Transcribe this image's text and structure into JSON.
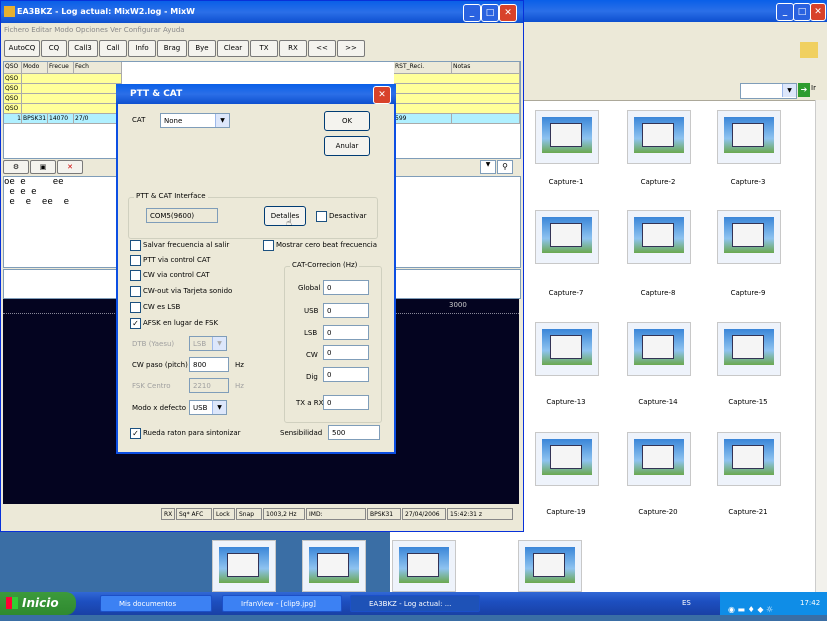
{
  "app": {
    "title": "EA3BKZ - Log actual: MixW2.log - MixW",
    "menu": "Fichero  Editar  Modo  Opciones  Ver  Configurar  Ayuda",
    "toolbar": [
      "AutoCQ",
      "CQ",
      "Call3",
      "Call",
      "Info",
      "Brag",
      "Bye",
      "Clear",
      "TX",
      "RX",
      "<<",
      ">>"
    ],
    "grid_headers": [
      "QSO",
      "Modo",
      "Frecue",
      "Fech",
      "",
      "",
      "",
      "",
      "",
      "RST_Reci.",
      "Notas"
    ],
    "grid_rows": [
      "QSO",
      "QSO",
      "QSO",
      "QSO"
    ],
    "grid_last": [
      "1",
      "BPSK31",
      "14070",
      "27/0",
      "",
      "",
      "",
      "",
      "",
      "599",
      ""
    ],
    "rx_line1": "oe e     ee",
    "rx_line2": " e e e",
    "rx_line3": " e  e  ee  e",
    "waterfall_freq": "3000",
    "status": {
      "rx": "RX",
      "sq": "Sq* AFC",
      "lock": "Lock",
      "snap": "Snap",
      "freq": "1003,2 Hz",
      "imd": "IMD:",
      "mode": "BPSK31",
      "date": "27/04/2006",
      "time": "15:42:31 z"
    }
  },
  "dialog": {
    "title": "PTT & CAT",
    "cat_label": "CAT",
    "cat_value": "None",
    "ok": "OK",
    "cancel": "Anular",
    "interface_group": "PTT & CAT Interface",
    "port": "COM5(9600)",
    "details": "Detalles",
    "deactivate": "Desactivar",
    "save_freq": "Salvar frecuencia al salir",
    "show_zero": "Mostrar cero beat frecuencia",
    "ptt_cat": "PTT via control CAT",
    "cw_cat": "CW via control CAT",
    "cw_sound": "CW-out via Tarjeta sonido",
    "cw_lsb": "CW es LSB",
    "afsk": "AFSK en lugar de FSK",
    "dtb": "DTB (Yaesu)",
    "dtb_val": "LSB",
    "cw_pitch": "CW paso (pitch)",
    "cw_pitch_val": "800",
    "hz": "Hz",
    "fsk_center": "FSK Centro",
    "fsk_val": "2210",
    "default_mode": "Modo x defecto",
    "default_mode_val": "USB",
    "cat_corr_group": "CAT-Correcion (Hz)",
    "corr": [
      {
        "label": "Global",
        "value": "0"
      },
      {
        "label": "USB",
        "value": "0"
      },
      {
        "label": "LSB",
        "value": "0"
      },
      {
        "label": "CW",
        "value": "0"
      },
      {
        "label": "Dig",
        "value": "0"
      }
    ],
    "tx_rx": "TX a RX",
    "tx_rx_val": "0",
    "wheel": "Rueda raton para sintonizar",
    "sens": "Sensibilidad",
    "sens_val": "500"
  },
  "explorer": {
    "captions": [
      "Capture-1",
      "Capture-2",
      "Capture-3",
      "Capture-7",
      "Capture-8",
      "Capture-9",
      "Capture-13",
      "Capture-14",
      "Capture-15",
      "Capture-19",
      "Capture-20",
      "Capture-21"
    ],
    "go": "Ir"
  },
  "taskbar": {
    "start": "Inicio",
    "items": [
      "Mis documentos",
      "IrfanView - [clip9.jpg]",
      "EA3BKZ - Log actual: ..."
    ],
    "lang": "ES",
    "clock": "17:42"
  }
}
